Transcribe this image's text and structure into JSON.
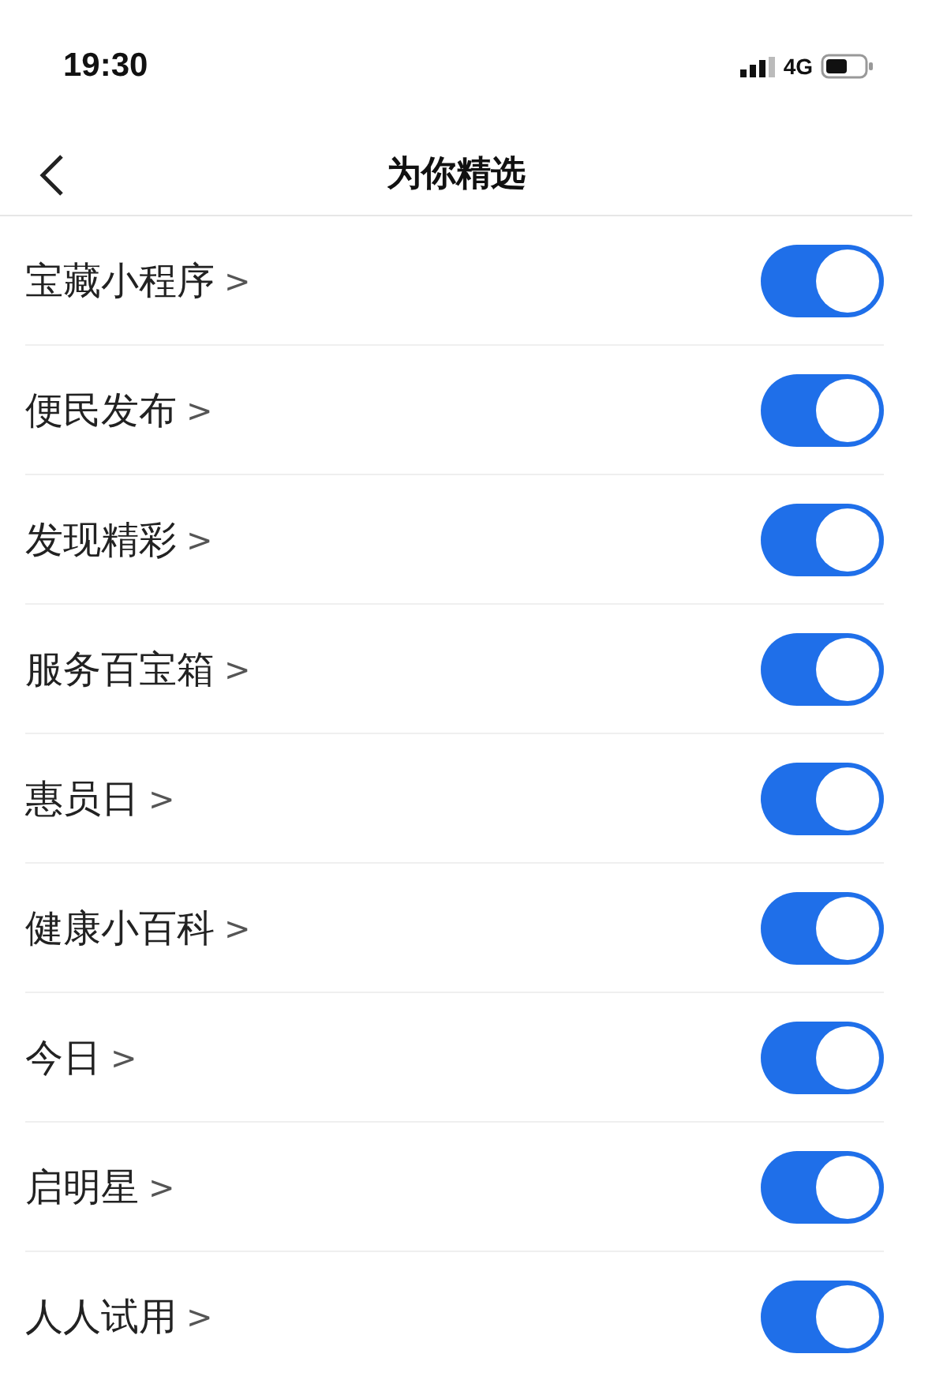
{
  "status_bar": {
    "time": "19:30",
    "network": "4G"
  },
  "nav": {
    "title": "为你精选"
  },
  "items": [
    {
      "label": "宝藏小程序",
      "arrow": ">",
      "on": true
    },
    {
      "label": "便民发布",
      "arrow": ">",
      "on": true
    },
    {
      "label": "发现精彩",
      "arrow": ">",
      "on": true
    },
    {
      "label": "服务百宝箱",
      "arrow": ">",
      "on": true
    },
    {
      "label": "惠员日",
      "arrow": ">",
      "on": true
    },
    {
      "label": "健康小百科",
      "arrow": ">",
      "on": true
    },
    {
      "label": "今日",
      "arrow": ">",
      "on": true
    },
    {
      "label": "启明星",
      "arrow": ">",
      "on": true
    },
    {
      "label": "人人试用",
      "arrow": ">",
      "on": true
    }
  ]
}
